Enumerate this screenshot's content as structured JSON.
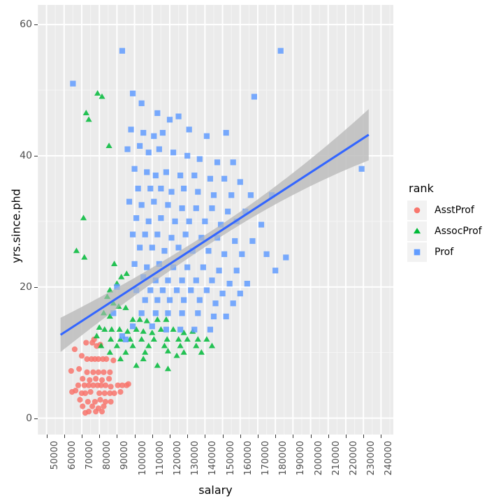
{
  "chart_data": {
    "type": "scatter",
    "title": "",
    "xlabel": "salary",
    "ylabel": "yrs.since.phd",
    "xlim": [
      45000,
      247000
    ],
    "ylim": [
      -2.5,
      63
    ],
    "x_ticks": [
      50000,
      60000,
      70000,
      80000,
      90000,
      100000,
      110000,
      120000,
      130000,
      140000,
      150000,
      160000,
      170000,
      180000,
      190000,
      200000,
      210000,
      220000,
      230000,
      240000
    ],
    "y_ticks": [
      0,
      20,
      40,
      60
    ],
    "grid": "major-and-minor",
    "legend_position": "right",
    "legend_title": "rank",
    "series": [
      {
        "name": "AsstProf",
        "color": "#f8766d",
        "shape": "circle",
        "points": [
          [
            72500,
            11.5
          ],
          [
            76000,
            11.5
          ],
          [
            78500,
            11.0
          ],
          [
            80500,
            11.2
          ],
          [
            70000,
            9.5
          ],
          [
            73000,
            9.0
          ],
          [
            75500,
            9.0
          ],
          [
            77500,
            9.0
          ],
          [
            79500,
            9.0
          ],
          [
            82000,
            9.0
          ],
          [
            84000,
            9.0
          ],
          [
            88000,
            8.8
          ],
          [
            68500,
            7.5
          ],
          [
            64000,
            7.2
          ],
          [
            73000,
            7.0
          ],
          [
            76500,
            7.0
          ],
          [
            79500,
            7.0
          ],
          [
            82500,
            7.0
          ],
          [
            86000,
            7.0
          ],
          [
            70500,
            6.0
          ],
          [
            74500,
            5.8
          ],
          [
            78000,
            6.0
          ],
          [
            81500,
            5.8
          ],
          [
            85500,
            6.0
          ],
          [
            68000,
            5.0
          ],
          [
            71500,
            5.0
          ],
          [
            74000,
            5.0
          ],
          [
            76500,
            5.0
          ],
          [
            79000,
            5.0
          ],
          [
            81000,
            5.0
          ],
          [
            83500,
            5.0
          ],
          [
            86500,
            4.8
          ],
          [
            90500,
            5.0
          ],
          [
            93000,
            5.0
          ],
          [
            95500,
            5.0
          ],
          [
            64500,
            4.0
          ],
          [
            70000,
            3.8
          ],
          [
            72000,
            3.8
          ],
          [
            75000,
            4.0
          ],
          [
            80000,
            3.8
          ],
          [
            83000,
            3.8
          ],
          [
            86000,
            3.8
          ],
          [
            88500,
            3.8
          ],
          [
            69000,
            2.8
          ],
          [
            73500,
            2.5
          ],
          [
            77500,
            2.5
          ],
          [
            80500,
            2.8
          ],
          [
            83500,
            2.5
          ],
          [
            86500,
            2.5
          ],
          [
            70500,
            1.8
          ],
          [
            76000,
            1.8
          ],
          [
            79500,
            1.5
          ],
          [
            82500,
            1.8
          ],
          [
            74000,
            1.0
          ],
          [
            78000,
            1.0
          ],
          [
            81500,
            1.0
          ],
          [
            72000,
            0.8
          ],
          [
            66000,
            10.5
          ],
          [
            66500,
            4.2
          ],
          [
            92000,
            4.0
          ],
          [
            96500,
            5.2
          ],
          [
            77000,
            12.0
          ]
        ]
      },
      {
        "name": "AssocProf",
        "color": "#00ba38",
        "shape": "triangle",
        "points": [
          [
            79000,
            49.5
          ],
          [
            81500,
            49.0
          ],
          [
            74000,
            45.5
          ],
          [
            72500,
            46.5
          ],
          [
            85500,
            41.5
          ],
          [
            71000,
            30.5
          ],
          [
            67000,
            25.5
          ],
          [
            71500,
            24.5
          ],
          [
            88500,
            23.5
          ],
          [
            95500,
            22.0
          ],
          [
            92500,
            21.5
          ],
          [
            90000,
            20.5
          ],
          [
            86000,
            19.5
          ],
          [
            84500,
            18.5
          ],
          [
            88000,
            17.5
          ],
          [
            91000,
            17.0
          ],
          [
            95000,
            16.8
          ],
          [
            82500,
            16.0
          ],
          [
            86000,
            15.5
          ],
          [
            99000,
            15.0
          ],
          [
            103000,
            15.0
          ],
          [
            107000,
            14.8
          ],
          [
            113000,
            15.0
          ],
          [
            118000,
            15.0
          ],
          [
            80000,
            13.8
          ],
          [
            83000,
            13.5
          ],
          [
            87000,
            13.5
          ],
          [
            91500,
            13.5
          ],
          [
            96000,
            13.2
          ],
          [
            101000,
            13.5
          ],
          [
            105000,
            13.2
          ],
          [
            110000,
            13.0
          ],
          [
            115000,
            13.5
          ],
          [
            122000,
            13.5
          ],
          [
            128000,
            13.0
          ],
          [
            133000,
            13.2
          ],
          [
            78500,
            12.5
          ],
          [
            86500,
            12.0
          ],
          [
            92000,
            12.0
          ],
          [
            97500,
            12.0
          ],
          [
            104000,
            12.0
          ],
          [
            111000,
            12.0
          ],
          [
            118500,
            12.0
          ],
          [
            125000,
            12.0
          ],
          [
            130000,
            12.0
          ],
          [
            136000,
            12.0
          ],
          [
            141000,
            12.0
          ],
          [
            81000,
            11.0
          ],
          [
            90000,
            11.0
          ],
          [
            99000,
            11.0
          ],
          [
            108000,
            11.0
          ],
          [
            117000,
            11.0
          ],
          [
            126000,
            11.0
          ],
          [
            135000,
            11.0
          ],
          [
            144000,
            11.0
          ],
          [
            86000,
            10.0
          ],
          [
            95000,
            10.0
          ],
          [
            106000,
            10.0
          ],
          [
            119000,
            10.2
          ],
          [
            128000,
            10.0
          ],
          [
            138000,
            10.0
          ],
          [
            92000,
            9.0
          ],
          [
            105000,
            9.0
          ],
          [
            124000,
            9.5
          ],
          [
            101000,
            8.0
          ],
          [
            113000,
            8.0
          ],
          [
            119000,
            7.5
          ]
        ]
      },
      {
        "name": "Prof",
        "color": "#619cff",
        "shape": "square",
        "points": [
          [
            93000,
            56.0
          ],
          [
            183000,
            56.0
          ],
          [
            65000,
            51.0
          ],
          [
            99000,
            49.5
          ],
          [
            168000,
            49.0
          ],
          [
            104000,
            48.0
          ],
          [
            113000,
            46.5
          ],
          [
            120000,
            45.5
          ],
          [
            125000,
            46.0
          ],
          [
            98000,
            44.0
          ],
          [
            105000,
            43.5
          ],
          [
            111000,
            43.0
          ],
          [
            116000,
            43.5
          ],
          [
            131000,
            44.0
          ],
          [
            141000,
            43.0
          ],
          [
            152000,
            43.5
          ],
          [
            96000,
            41.0
          ],
          [
            103000,
            41.5
          ],
          [
            108000,
            40.5
          ],
          [
            114000,
            41.0
          ],
          [
            122000,
            40.5
          ],
          [
            130000,
            40.0
          ],
          [
            137000,
            39.5
          ],
          [
            147000,
            39.0
          ],
          [
            156000,
            39.0
          ],
          [
            229000,
            38.0
          ],
          [
            100000,
            38.0
          ],
          [
            107000,
            37.5
          ],
          [
            112000,
            37.0
          ],
          [
            118000,
            37.5
          ],
          [
            126000,
            37.0
          ],
          [
            134000,
            37.0
          ],
          [
            143000,
            36.5
          ],
          [
            151000,
            36.5
          ],
          [
            160000,
            36.0
          ],
          [
            102000,
            35.0
          ],
          [
            109000,
            35.0
          ],
          [
            115000,
            35.0
          ],
          [
            121000,
            34.5
          ],
          [
            128000,
            35.0
          ],
          [
            136000,
            34.5
          ],
          [
            145000,
            34.0
          ],
          [
            155000,
            34.0
          ],
          [
            166000,
            34.0
          ],
          [
            178000,
            34.0
          ],
          [
            97000,
            33.0
          ],
          [
            104000,
            32.5
          ],
          [
            111000,
            33.0
          ],
          [
            119000,
            32.5
          ],
          [
            127000,
            32.0
          ],
          [
            135000,
            32.0
          ],
          [
            144000,
            32.0
          ],
          [
            153000,
            31.5
          ],
          [
            163000,
            31.5
          ],
          [
            101000,
            30.5
          ],
          [
            108000,
            30.0
          ],
          [
            115000,
            30.5
          ],
          [
            123000,
            30.0
          ],
          [
            131000,
            30.0
          ],
          [
            140000,
            30.0
          ],
          [
            149000,
            29.5
          ],
          [
            158000,
            30.0
          ],
          [
            172000,
            29.5
          ],
          [
            99000,
            28.0
          ],
          [
            106000,
            28.0
          ],
          [
            113000,
            28.0
          ],
          [
            121000,
            27.5
          ],
          [
            129000,
            28.0
          ],
          [
            138000,
            27.5
          ],
          [
            147000,
            27.5
          ],
          [
            157000,
            27.0
          ],
          [
            167000,
            27.0
          ],
          [
            103000,
            26.0
          ],
          [
            110000,
            26.0
          ],
          [
            117000,
            25.5
          ],
          [
            125000,
            26.0
          ],
          [
            133000,
            25.5
          ],
          [
            142000,
            25.5
          ],
          [
            151000,
            25.0
          ],
          [
            161000,
            25.0
          ],
          [
            175000,
            25.0
          ],
          [
            186000,
            24.5
          ],
          [
            100000,
            23.5
          ],
          [
            107000,
            23.0
          ],
          [
            114000,
            23.5
          ],
          [
            122000,
            23.0
          ],
          [
            130000,
            23.0
          ],
          [
            139000,
            23.0
          ],
          [
            148000,
            22.5
          ],
          [
            158000,
            22.5
          ],
          [
            180000,
            22.5
          ],
          [
            105000,
            21.5
          ],
          [
            112000,
            21.0
          ],
          [
            119000,
            21.0
          ],
          [
            127000,
            21.0
          ],
          [
            135000,
            21.0
          ],
          [
            144000,
            21.0
          ],
          [
            154000,
            20.5
          ],
          [
            164000,
            20.5
          ],
          [
            101000,
            19.5
          ],
          [
            109000,
            19.5
          ],
          [
            116000,
            19.5
          ],
          [
            124000,
            19.5
          ],
          [
            132000,
            19.5
          ],
          [
            141000,
            19.5
          ],
          [
            150000,
            19.0
          ],
          [
            160000,
            19.0
          ],
          [
            106000,
            18.0
          ],
          [
            113000,
            18.0
          ],
          [
            120000,
            18.0
          ],
          [
            128000,
            18.0
          ],
          [
            137000,
            18.0
          ],
          [
            146000,
            17.5
          ],
          [
            156000,
            17.5
          ],
          [
            104000,
            16.0
          ],
          [
            112000,
            16.0
          ],
          [
            119000,
            16.0
          ],
          [
            127000,
            16.0
          ],
          [
            136000,
            16.0
          ],
          [
            145000,
            15.5
          ],
          [
            152000,
            15.5
          ],
          [
            99000,
            14.0
          ],
          [
            110000,
            14.0
          ],
          [
            118000,
            13.5
          ],
          [
            126000,
            13.5
          ],
          [
            134000,
            13.5
          ],
          [
            143000,
            13.5
          ],
          [
            95000,
            12.0
          ],
          [
            93000,
            12.5
          ],
          [
            88000,
            16.0
          ],
          [
            90000,
            20.0
          ]
        ]
      }
    ],
    "smooth": {
      "method": "lm",
      "line_color": "#3366ff",
      "ribbon_color": "#c0c0c0",
      "x_start": 58000,
      "x_end": 233000,
      "y_start": 12.7,
      "y_end": 43.2,
      "band_half_width_start": 2.6,
      "band_half_width_end": 3.9,
      "band_half_width_mid": 0.9
    }
  },
  "axes": {
    "x": {
      "title": "salary",
      "tick_labels": [
        "50000",
        "60000",
        "70000",
        "80000",
        "90000",
        "100000",
        "110000",
        "120000",
        "130000",
        "140000",
        "150000",
        "160000",
        "170000",
        "180000",
        "190000",
        "200000",
        "210000",
        "220000",
        "230000",
        "240000"
      ]
    },
    "y": {
      "title": "yrs.since.phd",
      "tick_labels": [
        "0",
        "20",
        "40",
        "60"
      ]
    }
  },
  "legend": {
    "title": "rank",
    "items": [
      {
        "label": "AsstProf",
        "color": "#f8766d",
        "shape": "circle",
        "icon": "circle-marker-icon"
      },
      {
        "label": "AssocProf",
        "color": "#00ba38",
        "shape": "triangle",
        "icon": "triangle-marker-icon"
      },
      {
        "label": "Prof",
        "color": "#619cff",
        "shape": "square",
        "icon": "square-marker-icon"
      }
    ]
  },
  "theme": {
    "panel_background": "#ebebeb",
    "grid_major": "#ffffff",
    "grid_minor": "#f5f5f5",
    "plot_background": "#ffffff",
    "axis_text": "#4d4d4d",
    "axis_title": "#000000",
    "legend_key_background": "#f2f2f2"
  }
}
